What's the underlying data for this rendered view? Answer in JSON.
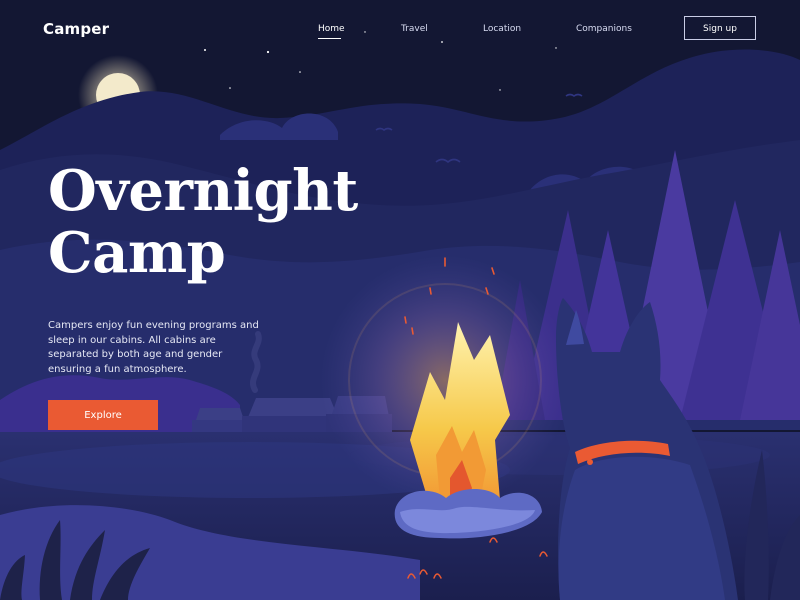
{
  "brand": {
    "name": "Camper"
  },
  "nav": {
    "items": [
      {
        "label": "Home",
        "active": true
      },
      {
        "label": "Travel",
        "active": false
      },
      {
        "label": "Location",
        "active": false
      },
      {
        "label": "Companions",
        "active": false
      }
    ],
    "signup_label": "Sign up"
  },
  "hero": {
    "title_line1": "Overnight",
    "title_line2": "Camp",
    "description": "Campers enjoy fun evening programs and sleep in our cabins. All cabins are separated by both age and gender ensuring a fun atmosphere.",
    "cta_label": "Explore"
  },
  "colors": {
    "sky": "#131733",
    "accent": "#ea5a33",
    "fire": "#f6c94a",
    "trees": "#4a3aa0"
  },
  "illustration": {
    "scene": "night-campfire-with-dog",
    "icons": [
      "moon-icon",
      "campfire-icon",
      "dog-icon",
      "cabin-icon",
      "pine-tree-icon",
      "bird-icon"
    ]
  }
}
